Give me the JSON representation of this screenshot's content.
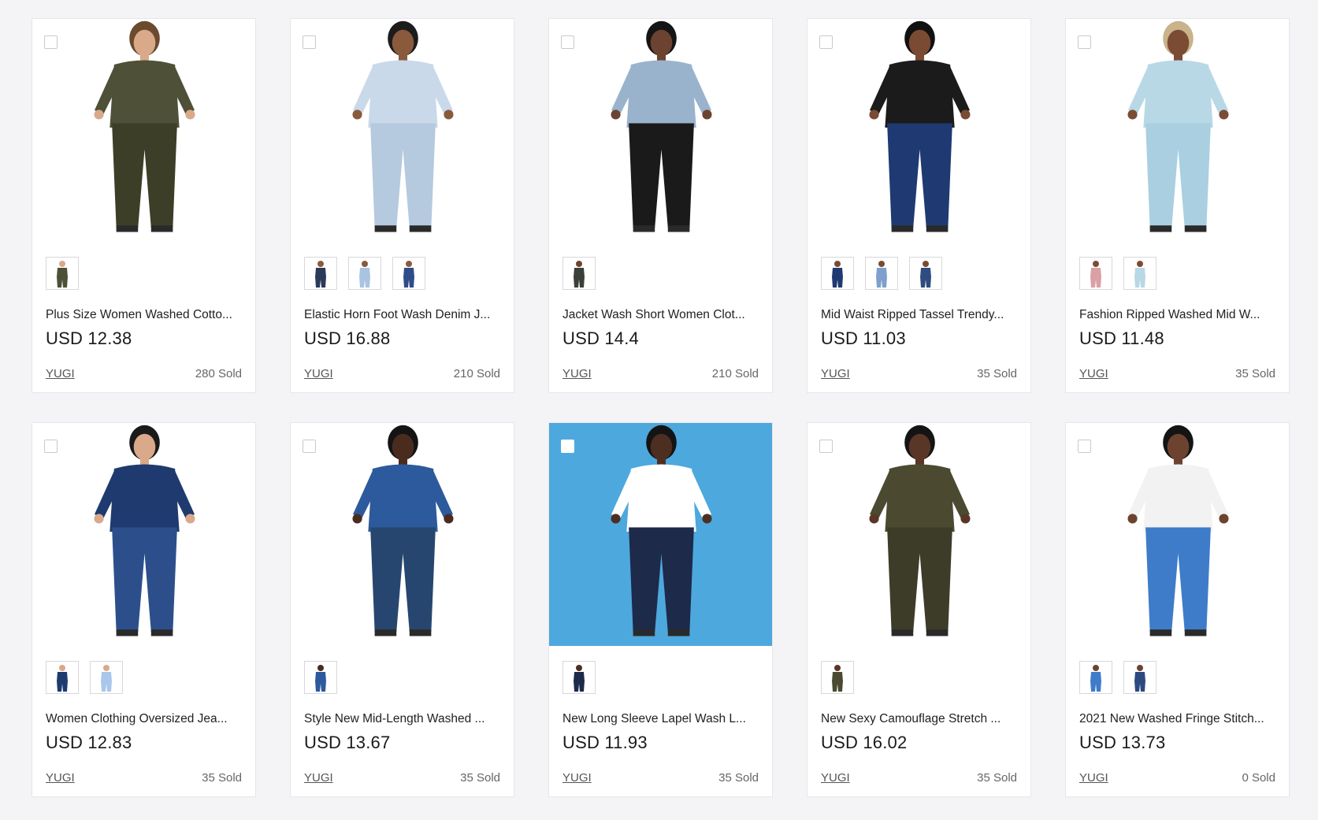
{
  "products": [
    {
      "title": "Plus Size Women Washed Cotto...",
      "price": "USD 12.38",
      "seller": "YUGI",
      "sold": "280 Sold",
      "outfit_colors": [
        "#4e5037",
        "#3c3e28"
      ],
      "skin": "#d9a98a",
      "hair": "#6b4a2e",
      "swatch_colors": [
        "#4e5037"
      ],
      "background": "#ffffff"
    },
    {
      "title": "Elastic Horn Foot Wash Denim J...",
      "price": "USD 16.88",
      "seller": "YUGI",
      "sold": "210 Sold",
      "outfit_colors": [
        "#c9d9ea",
        "#b5c9df"
      ],
      "skin": "#8a5a3c",
      "hair": "#1c1c1c",
      "swatch_colors": [
        "#2c3a5a",
        "#a8c4e0",
        "#2f4c8a"
      ],
      "background": "#ffffff"
    },
    {
      "title": "Jacket Wash Short Women Clot...",
      "price": "USD 14.4",
      "seller": "YUGI",
      "sold": "210 Sold",
      "outfit_colors": [
        "#9ab3cc",
        "#1a1a1a"
      ],
      "skin": "#6b4330",
      "hair": "#151515",
      "swatch_colors": [
        "#3a4038"
      ],
      "background": "#ffffff"
    },
    {
      "title": "Mid Waist Ripped Tassel Trendy...",
      "price": "USD 11.03",
      "seller": "YUGI",
      "sold": "35 Sold",
      "outfit_colors": [
        "#1b1b1b",
        "#1f3a72"
      ],
      "skin": "#7a4a33",
      "hair": "#111111",
      "swatch_colors": [
        "#1f3a72",
        "#7fa0cc",
        "#2e4c80"
      ],
      "background": "#ffffff"
    },
    {
      "title": "Fashion Ripped Washed Mid W...",
      "price": "USD 11.48",
      "seller": "YUGI",
      "sold": "35 Sold",
      "outfit_colors": [
        "#b8d8e6",
        "#a9cfe0"
      ],
      "skin": "#7b4b33",
      "hair": "#c8b38a",
      "swatch_colors": [
        "#d9a0a6",
        "#b8d8e6"
      ],
      "background": "#ffffff"
    },
    {
      "title": "Women Clothing Oversized Jea...",
      "price": "USD 12.83",
      "seller": "YUGI",
      "sold": "35 Sold",
      "outfit_colors": [
        "#1f3a6e",
        "#2c4f8c"
      ],
      "skin": "#d9a98a",
      "hair": "#1a1a1a",
      "swatch_colors": [
        "#1f3a6e",
        "#a9c7ea"
      ],
      "background": "#ffffff"
    },
    {
      "title": "Style New Mid-Length Washed ...",
      "price": "USD 13.67",
      "seller": "YUGI",
      "sold": "35 Sold",
      "outfit_colors": [
        "#2d5a9c",
        "#27466f"
      ],
      "skin": "#4a2c1f",
      "hair": "#141414",
      "swatch_colors": [
        "#2d5a9c"
      ],
      "background": "#ffffff"
    },
    {
      "title": "New Long Sleeve Lapel Wash L...",
      "price": "USD 11.93",
      "seller": "YUGI",
      "sold": "35 Sold",
      "outfit_colors": [
        "#ffffff",
        "#1d2a4a"
      ],
      "skin": "#4d2f22",
      "hair": "#141414",
      "swatch_colors": [
        "#1d2a4a"
      ],
      "background": "#4da8dd"
    },
    {
      "title": "New Sexy Camouflage Stretch ...",
      "price": "USD 16.02",
      "seller": "YUGI",
      "sold": "35 Sold",
      "outfit_colors": [
        "#4b4a31",
        "#3d3c28"
      ],
      "skin": "#5a3626",
      "hair": "#141414",
      "swatch_colors": [
        "#4b4a31"
      ],
      "background": "#ffffff"
    },
    {
      "title": "2021 New Washed Fringe Stitch...",
      "price": "USD 13.73",
      "seller": "YUGI",
      "sold": "0 Sold",
      "outfit_colors": [
        "#f2f2f2",
        "#3e7cc9"
      ],
      "skin": "#6d432f",
      "hair": "#141414",
      "swatch_colors": [
        "#3e7cc9",
        "#2d4a80"
      ],
      "background": "#ffffff"
    }
  ]
}
